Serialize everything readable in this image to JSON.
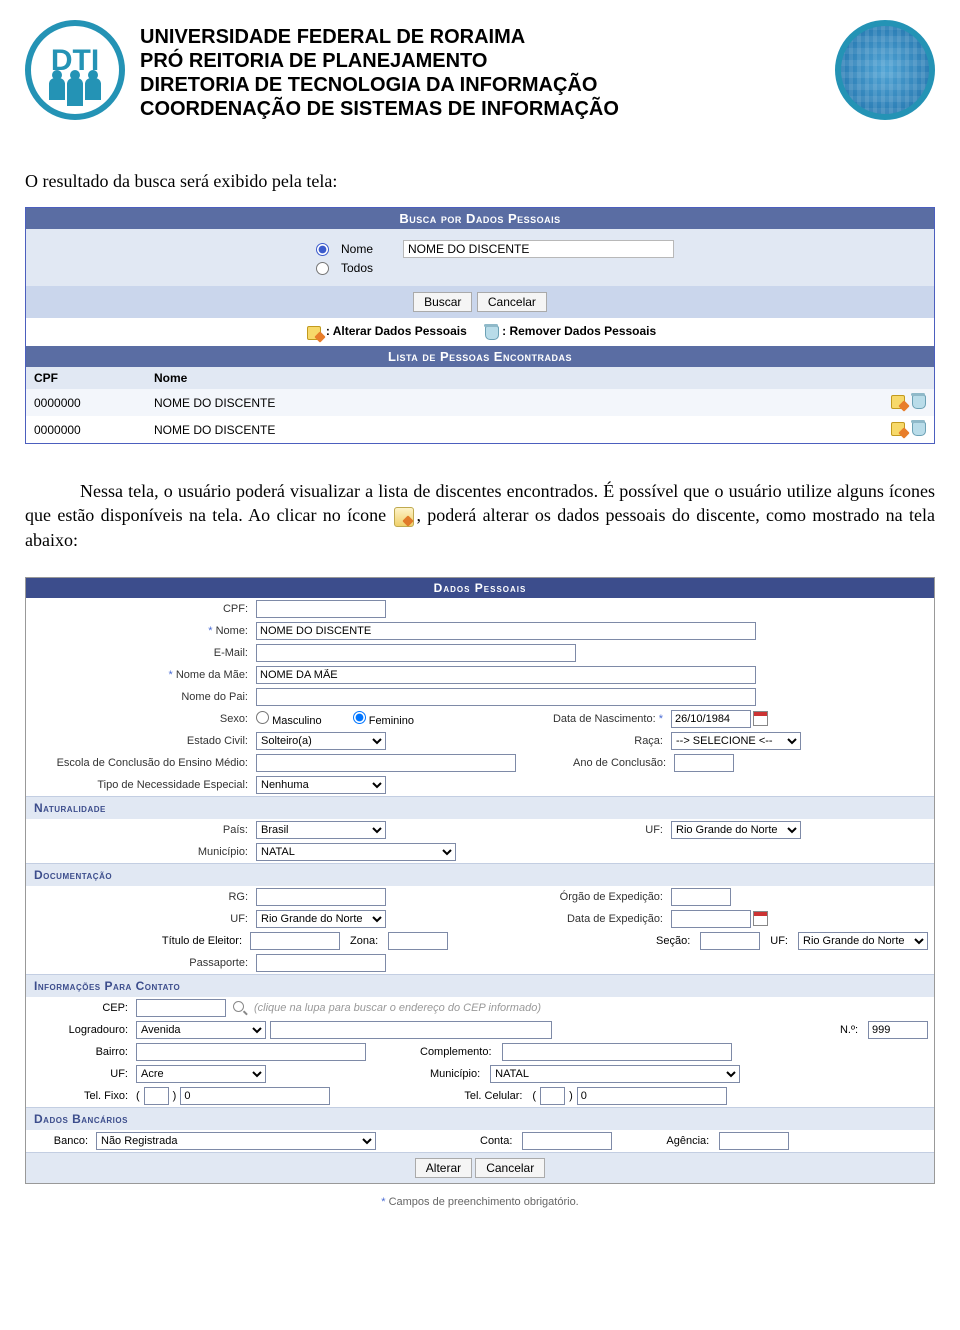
{
  "header": {
    "line1": "UNIVERSIDADE FEDERAL DE RORAIMA",
    "line2": "PRÓ REITORIA DE PLANEJAMENTO",
    "line3": "DIRETORIA DE TECNOLOGIA DA INFORMAÇÃO",
    "line4": "COORDENAÇÃO DE SISTEMAS DE INFORMAÇÃO",
    "dti": "DTI"
  },
  "intro": "O resultado da busca será exibido pela tela:",
  "search": {
    "title": "Busca por Dados Pessoais",
    "opt_nome": "Nome",
    "opt_todos": "Todos",
    "input_value": "NOME DO DISCENTE",
    "btn_buscar": "Buscar",
    "btn_cancelar": "Cancelar"
  },
  "legend": {
    "alterar": ": Alterar Dados Pessoais",
    "remover": ": Remover Dados Pessoais"
  },
  "list": {
    "title": "Lista de Pessoas Encontradas",
    "col_cpf": "CPF",
    "col_nome": "Nome",
    "rows": [
      {
        "cpf": "0000000",
        "nome": "NOME DO DISCENTE"
      },
      {
        "cpf": "0000000",
        "nome": "NOME DO DISCENTE"
      }
    ]
  },
  "para": {
    "p1a": "Nessa tela, o usuário poderá visualizar a lista de discentes encontrados. É possível que o usuário utilize alguns ícones que estão disponíveis na tela. Ao clicar no ícone ",
    "p1b": ", poderá alterar os dados pessoais do discente, como mostrado na tela abaixo:"
  },
  "form": {
    "title": "Dados Pessoais",
    "cpf_label": "CPF:",
    "nome_label": "Nome:",
    "nome_value": "NOME DO DISCENTE",
    "email_label": "E-Mail:",
    "mae_label": "Nome da Mãe:",
    "mae_value": "NOME DA MÃE",
    "pai_label": "Nome do Pai:",
    "sexo_label": "Sexo:",
    "sexo_m": "Masculino",
    "sexo_f": "Feminino",
    "dnasc_label": "Data de Nascimento:",
    "dnasc_value": "26/10/1984",
    "civil_label": "Estado Civil:",
    "civil_value": "Solteiro(a)",
    "raca_label": "Raça:",
    "raca_value": "--> SELECIONE <--",
    "escola_label": "Escola de Conclusão do Ensino Médio:",
    "ano_label": "Ano de Conclusão:",
    "nec_label": "Tipo de Necessidade Especial:",
    "nec_value": "Nenhuma",
    "sect_nat": "Naturalidade",
    "pais_label": "País:",
    "pais_value": "Brasil",
    "uf_label": "UF:",
    "uf_value": "Rio Grande do Norte",
    "mun_label": "Município:",
    "mun_value": "NATAL",
    "sect_doc": "Documentação",
    "rg_label": "RG:",
    "orgao_label": "Órgão de Expedição:",
    "uf2_label": "UF:",
    "uf2_value": "Rio Grande do Norte",
    "dexp_label": "Data de Expedição:",
    "titulo_label": "Título de Eleitor:",
    "zona_label": "Zona:",
    "secao_label": "Seção:",
    "uf3_label": "UF:",
    "uf3_value": "Rio Grande do Norte",
    "pass_label": "Passaporte:",
    "sect_contato": "Informações Para Contato",
    "cep_label": "CEP:",
    "cep_hint": "(clique na lupa para buscar o endereço do CEP informado)",
    "log_label": "Logradouro:",
    "log_value": "Avenida",
    "num_label": "N.º:",
    "num_value": "999",
    "bairro_label": "Bairro:",
    "comp_label": "Complemento:",
    "uf4_label": "UF:",
    "uf4_value": "Acre",
    "mun2_label": "Município:",
    "mun2_value": "NATAL",
    "tfixo_label": "Tel. Fixo:",
    "tcel_label": "Tel. Celular:",
    "t_par1": "(",
    "t_par2": ")",
    "t_zero": "0",
    "sect_banco": "Dados Bancários",
    "banco_label": "Banco:",
    "banco_value": "Não Registrada",
    "conta_label": "Conta:",
    "agencia_label": "Agência:",
    "btn_alterar": "Alterar",
    "btn_cancelar": "Cancelar"
  },
  "footnote_star": "*",
  "footnote": "Campos de preenchimento obrigatório."
}
